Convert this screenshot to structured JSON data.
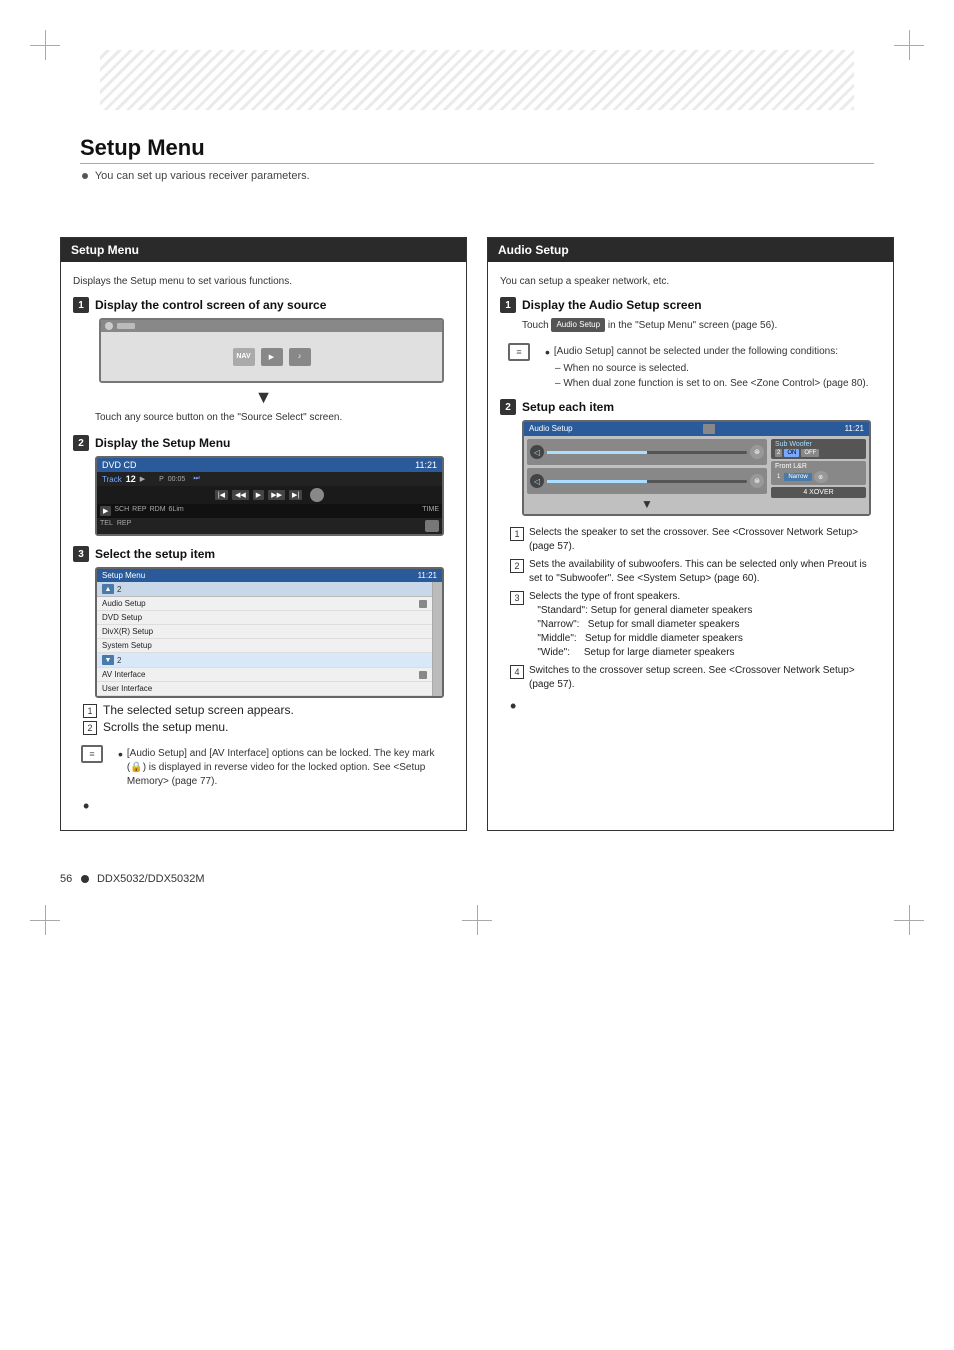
{
  "page": {
    "title": "Setup Menu",
    "subtitle": "You can set up various receiver parameters.",
    "footer": "56",
    "model": "DDX5032/DDX5032M"
  },
  "left_section": {
    "header": "Setup Menu",
    "description": "Displays the Setup menu to set various functions.",
    "steps": [
      {
        "num": "1",
        "title": "Display the control screen of any source",
        "desc": "Touch any source button on the \"Source Select\" screen."
      },
      {
        "num": "2",
        "title": "Display the Setup Menu",
        "screen": {
          "source": "DVD CD",
          "track_label": "Track",
          "track_num": "12",
          "p_label": "P",
          "time": "00:05"
        }
      },
      {
        "num": "3",
        "title": "Select the setup item",
        "menu_items": [
          "Audio Setup",
          "DVD Setup",
          "DivX(R) Setup",
          "System Setup",
          "AV Interface",
          "User Interface"
        ]
      }
    ],
    "annotations": [
      {
        "num": "1",
        "text": "The selected setup screen appears."
      },
      {
        "num": "2",
        "text": "Scrolls the setup menu."
      }
    ],
    "note": "[Audio Setup]  and [AV Interface] options can be locked. The key mark (🔒) is displayed in reverse video for the locked option. See <Setup Memory> (page 77)."
  },
  "right_section": {
    "header": "Audio Setup",
    "description": "You can setup a speaker network, etc.",
    "steps": [
      {
        "num": "1",
        "title": "Display the Audio Setup screen",
        "touch_label": "Audio Setup",
        "touch_desc": "in the \"Setup Menu\" screen (page 56)."
      },
      {
        "num": "2",
        "title": "Setup each item"
      }
    ],
    "notes": [
      "[Audio Setup] cannot be selected under the following conditions:",
      "– When no source is selected.",
      "– When dual zone function is set to on. See <Zone Control> (page 80)."
    ],
    "num_items": [
      {
        "num": "1",
        "text": "Selects the speaker to set the crossover. See <Crossover Network Setup> (page 57)."
      },
      {
        "num": "2",
        "text": "Sets the availability of subwoofers. This can be selected only when Preout is set to \"Subwoofer\". See <System Setup> (page 60)."
      },
      {
        "num": "3",
        "text": "Selects the type of front speakers. \"Standard\": Setup for general diameter speakers \"Narrow\":   Setup for small diameter speakers \"Middle\":   Setup for middle diameter speakers \"Wide\":     Setup for large diameter speakers"
      },
      {
        "num": "4",
        "text": "Switches to the crossover setup screen. See <Crossover Network Setup> (page 57)."
      }
    ]
  }
}
